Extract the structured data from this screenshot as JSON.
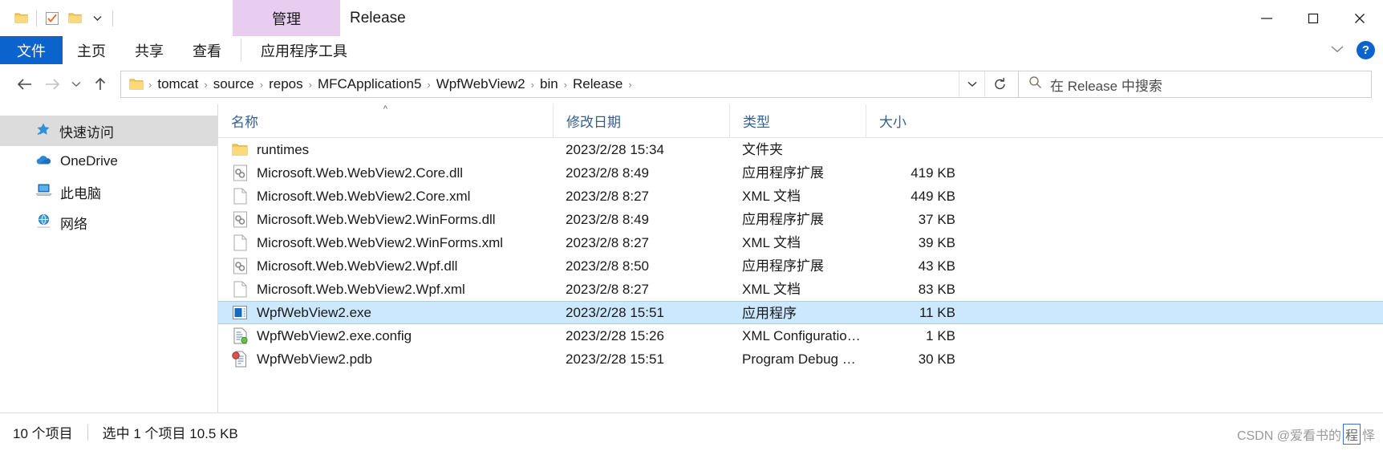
{
  "window": {
    "title": "Release",
    "context_tab": "管理",
    "minimize_icon": "minimize-icon",
    "maximize_icon": "maximize-icon",
    "close_icon": "close-icon"
  },
  "quick_access_toolbar": {
    "items": [
      {
        "name": "explorer-folder-icon",
        "icon": "folder-icon"
      },
      {
        "name": "properties-checkbox-icon",
        "icon": "checkbox-icon"
      },
      {
        "name": "new-folder-icon",
        "icon": "folder-icon"
      },
      {
        "name": "customize-dropdown-icon",
        "icon": "chevron-down-icon"
      }
    ]
  },
  "ribbon": {
    "tabs": [
      {
        "label": "文件",
        "active": true
      },
      {
        "label": "主页",
        "active": false
      },
      {
        "label": "共享",
        "active": false
      },
      {
        "label": "查看",
        "active": false
      },
      {
        "label": "应用程序工具",
        "active": false,
        "contextual": true
      }
    ],
    "collapse_label": "chevron-down-icon",
    "help_label": "?"
  },
  "navigation": {
    "back": "back-arrow-icon",
    "forward": "forward-arrow-icon",
    "recent": "chevron-down-icon",
    "up": "up-arrow-icon",
    "breadcrumbs": [
      "tomcat",
      "source",
      "repos",
      "MFCApplication5",
      "WpfWebView2",
      "bin",
      "Release"
    ],
    "separator": "›",
    "dropdown_icon": "chevron-down-icon",
    "refresh_icon": "refresh-icon"
  },
  "search": {
    "icon": "search-icon",
    "placeholder": "在 Release 中搜索"
  },
  "sidebar": {
    "items": [
      {
        "label": "快速访问",
        "icon": "pin-star-icon",
        "selected": true
      },
      {
        "label": "OneDrive",
        "icon": "cloud-icon",
        "selected": false
      },
      {
        "label": "此电脑",
        "icon": "computer-icon",
        "selected": false
      },
      {
        "label": "网络",
        "icon": "network-icon",
        "selected": false
      }
    ]
  },
  "file_list": {
    "columns": [
      {
        "key": "name",
        "label": "名称",
        "sorted": "asc"
      },
      {
        "key": "date",
        "label": "修改日期",
        "sorted": ""
      },
      {
        "key": "type",
        "label": "类型",
        "sorted": ""
      },
      {
        "key": "size",
        "label": "大小",
        "sorted": ""
      }
    ],
    "rows": [
      {
        "name": "runtimes",
        "date": "2023/2/28 15:34",
        "type": "文件夹",
        "size": "",
        "icon": "folder-icon",
        "selected": false
      },
      {
        "name": "Microsoft.Web.WebView2.Core.dll",
        "date": "2023/2/8 8:49",
        "type": "应用程序扩展",
        "size": "419 KB",
        "icon": "dll-icon",
        "selected": false
      },
      {
        "name": "Microsoft.Web.WebView2.Core.xml",
        "date": "2023/2/8 8:27",
        "type": "XML 文档",
        "size": "449 KB",
        "icon": "xml-document-icon",
        "selected": false
      },
      {
        "name": "Microsoft.Web.WebView2.WinForms.dll",
        "date": "2023/2/8 8:49",
        "type": "应用程序扩展",
        "size": "37 KB",
        "icon": "dll-icon",
        "selected": false
      },
      {
        "name": "Microsoft.Web.WebView2.WinForms.xml",
        "date": "2023/2/8 8:27",
        "type": "XML 文档",
        "size": "39 KB",
        "icon": "xml-document-icon",
        "selected": false
      },
      {
        "name": "Microsoft.Web.WebView2.Wpf.dll",
        "date": "2023/2/8 8:50",
        "type": "应用程序扩展",
        "size": "43 KB",
        "icon": "dll-icon",
        "selected": false
      },
      {
        "name": "Microsoft.Web.WebView2.Wpf.xml",
        "date": "2023/2/8 8:27",
        "type": "XML 文档",
        "size": "83 KB",
        "icon": "xml-document-icon",
        "selected": false
      },
      {
        "name": "WpfWebView2.exe",
        "date": "2023/2/28 15:51",
        "type": "应用程序",
        "size": "11 KB",
        "icon": "application-icon",
        "selected": true
      },
      {
        "name": "WpfWebView2.exe.config",
        "date": "2023/2/28 15:26",
        "type": "XML Configuration ...",
        "size": "1 KB",
        "icon": "config-icon",
        "selected": false
      },
      {
        "name": "WpfWebView2.pdb",
        "date": "2023/2/28 15:51",
        "type": "Program Debug Da...",
        "size": "30 KB",
        "icon": "pdb-icon",
        "selected": false
      }
    ]
  },
  "statusbar": {
    "item_count": "10 个项目",
    "selection": "选中 1 个项目  10.5 KB"
  },
  "watermark": {
    "prefix": "CSDN @爱看书的",
    "boxed": "程",
    "suffix": "怿"
  },
  "colors": {
    "accent": "#0b63ce",
    "selection": "#cce8ff",
    "contextual_tab": "#e8cdf0",
    "header_text": "#33608f"
  }
}
